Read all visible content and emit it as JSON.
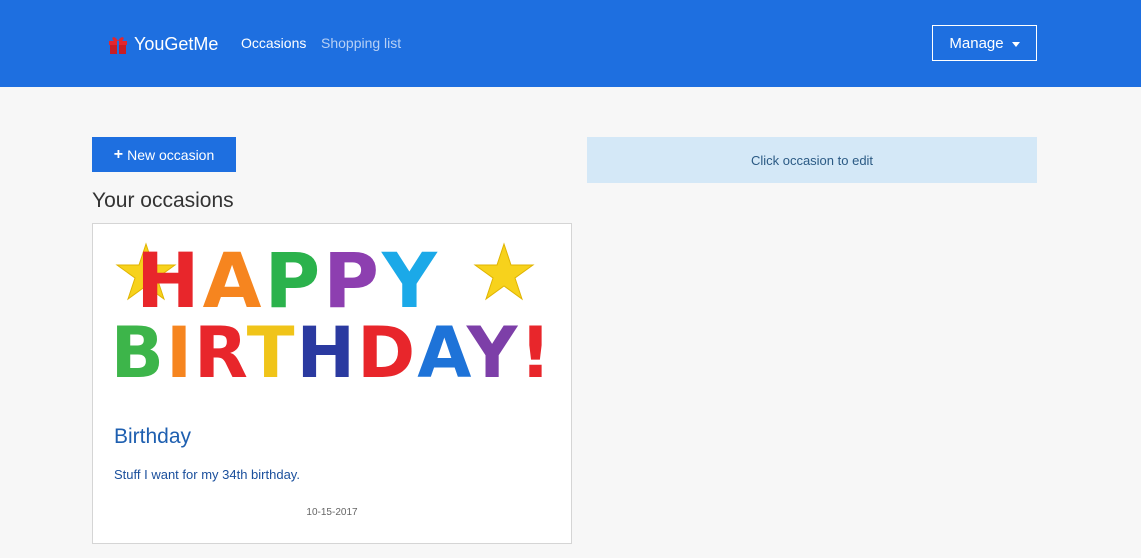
{
  "navbar": {
    "brand": "YouGetMe",
    "brand_icon": "gift-icon",
    "links": [
      {
        "label": "Occasions",
        "active": true
      },
      {
        "label": "Shopping list",
        "active": false
      }
    ],
    "manage_label": "Manage",
    "color": "#1e6fe0"
  },
  "main": {
    "new_button_label": "New occasion",
    "section_title": "Your occasions",
    "edit_hint": "Click occasion to edit",
    "occasions": [
      {
        "banner_line1": "HAPPY",
        "banner_line2": "BIRTHDAY!",
        "title": "Birthday",
        "description": "Stuff I want for my 34th birthday.",
        "date": "10-15-2017"
      }
    ]
  },
  "colors": {
    "accent": "#1e6fe0",
    "alert_bg": "#d4e8f7",
    "star": "#f7d21c"
  }
}
